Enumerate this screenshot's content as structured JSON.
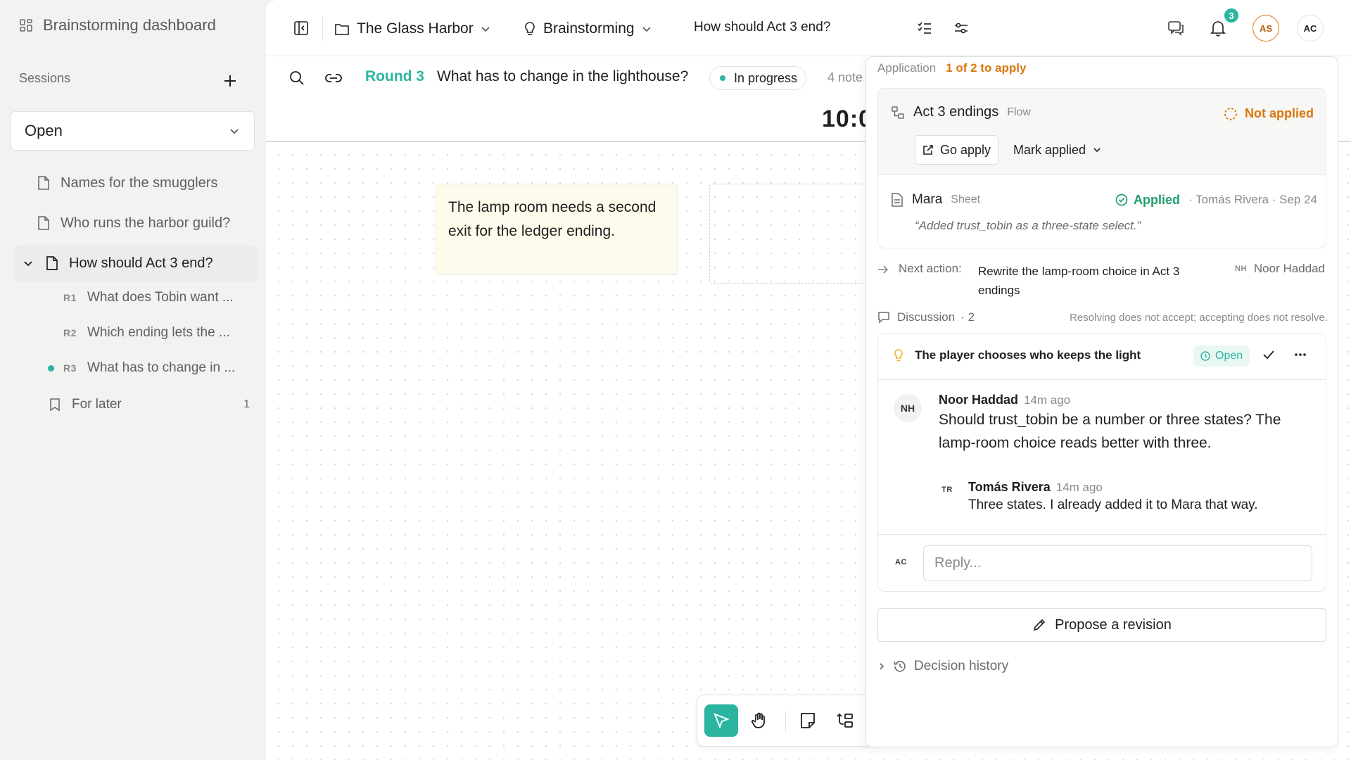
{
  "sidebar": {
    "title": "Brainstorming dashboard",
    "sessions_label": "Sessions",
    "filter_value": "Open",
    "items": [
      {
        "label": "Names for the smugglers"
      },
      {
        "label": "Who runs the harbor guild?"
      },
      {
        "label": "How should Act 3 end?"
      }
    ],
    "rounds": [
      {
        "rank": "R1",
        "label": "What does Tobin want ..."
      },
      {
        "rank": "R2",
        "label": "Which ending lets the ..."
      },
      {
        "rank": "R3",
        "label": "What has to change in ..."
      }
    ],
    "for_later": {
      "label": "For later",
      "count": "1"
    }
  },
  "topbar": {
    "project": "The Glass Harbor",
    "mode": "Brainstorming",
    "question": "How should Act 3 end?",
    "notification_count": "3",
    "avatars": [
      "AS",
      "AC"
    ]
  },
  "round": {
    "label": "Round 3",
    "question": "What has to change in the lighthouse?",
    "status": "In progress",
    "notes": "4 note",
    "timer": "10:0"
  },
  "canvas": {
    "sticky_text": "The lamp room needs a second exit for the ledger ending."
  },
  "panel": {
    "application_label": "Application",
    "application_count": "1 of 2 to apply",
    "target": {
      "name": "Act 3 endings",
      "type": "Flow",
      "status": "Not applied"
    },
    "go_apply": "Go apply",
    "mark_applied": "Mark applied",
    "sheet": {
      "name": "Mara",
      "type": "Sheet",
      "status": "Applied",
      "meta": "· Tomás Rivera · Sep 24",
      "quote": "“Added trust_tobin as a three-state select.”"
    },
    "next_action": {
      "label": "Next action:",
      "text": "Rewrite the lamp-room choice in Act 3 endings",
      "assignee_initials": "NH",
      "assignee": "Noor Haddad"
    },
    "discussion": {
      "label": "Discussion",
      "count": "· 2",
      "hint": "Resolving does not accept; accepting does not resolve."
    },
    "thread": {
      "title": "The player chooses who keeps the light",
      "status": "Open",
      "comments": [
        {
          "initials": "NH",
          "name": "Noor Haddad",
          "time": "14m ago",
          "body": "Should trust_tobin be a number or three states? The lamp-room choice reads better with three."
        },
        {
          "initials": "TR",
          "name": "Tomás Rivera",
          "time": "14m ago",
          "body": "Three states. I already added it to Mara that way."
        }
      ],
      "reply_initials": "AC",
      "reply_placeholder": "Reply..."
    },
    "propose": "Propose a revision",
    "history": "Decision history"
  },
  "colors": {
    "accent": "#2bb5a0",
    "warning": "#d9770b",
    "success": "#1f9e6a"
  }
}
